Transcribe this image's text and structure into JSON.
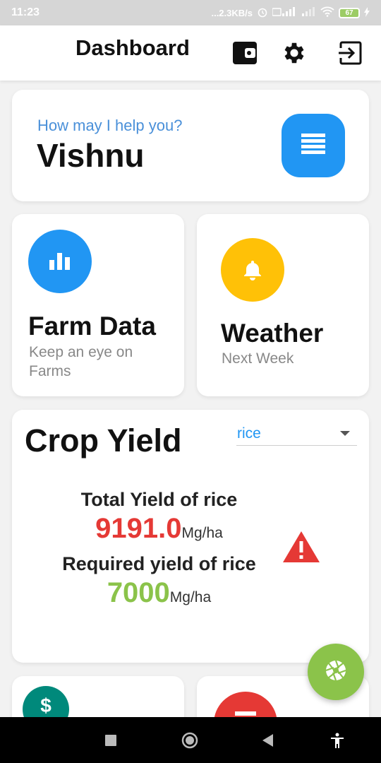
{
  "status_bar": {
    "time": "11:23",
    "network_speed": "...2.3KB/s",
    "battery": "67"
  },
  "app_bar": {
    "title": "Dashboard",
    "icons": [
      "wallet-icon",
      "gear-icon",
      "logout-icon"
    ]
  },
  "greeting": {
    "subtitle": "How may I help you?",
    "name": "Vishnu",
    "menu_icon": "list-icon"
  },
  "tiles": [
    {
      "title": "Farm Data",
      "subtitle": "Keep an eye on Farms",
      "icon": "bar-chart-icon",
      "color": "#2196f3"
    },
    {
      "title": "Weather",
      "subtitle": "Next Week",
      "icon": "bell-icon",
      "color": "#ffc107"
    }
  ],
  "crop_yield": {
    "title": "Crop Yield",
    "selected_crop": "rice",
    "total_label": "Total Yield of rice",
    "total_value": "9191.0",
    "total_unit": "Mg/ha",
    "required_label": "Required yield of rice",
    "required_value": "7000",
    "required_unit": "Mg/ha",
    "warning_icon": "warning-icon",
    "colors": {
      "total": "#e53935",
      "required": "#8bc34a",
      "warning": "#e53935"
    }
  },
  "bottom_tiles": [
    {
      "icon": "dollar-icon",
      "glyph": "$",
      "color": "#00897b"
    },
    {
      "icon": "minus-icon",
      "color": "#e53935"
    }
  ],
  "fab": {
    "icon": "camera-aperture-icon",
    "color": "#8bc34a"
  },
  "nav_bar": {
    "icons": [
      "recents-icon",
      "home-icon",
      "back-icon",
      "accessibility-icon"
    ]
  },
  "colors": {
    "accent": "#2196f3",
    "background": "#f2f2f2"
  }
}
